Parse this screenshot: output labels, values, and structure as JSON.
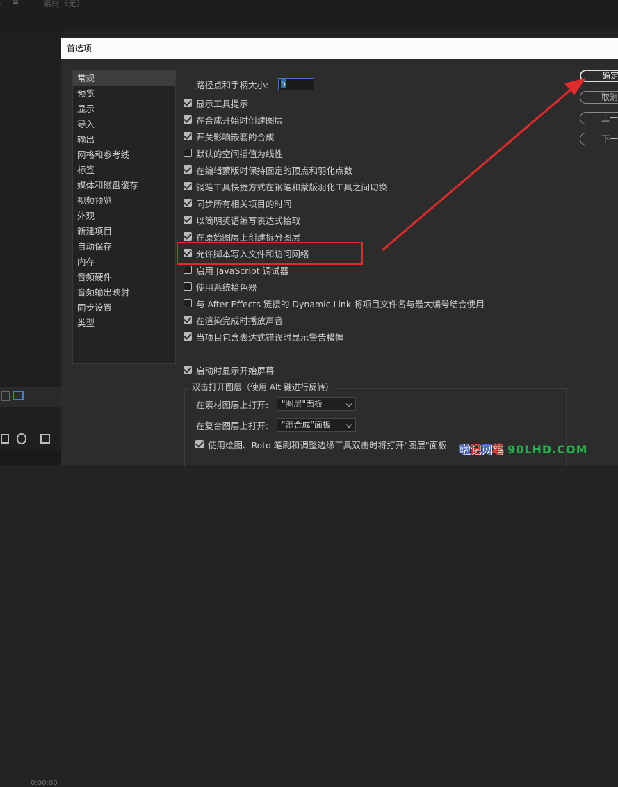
{
  "background_app": {
    "tab_active": "1",
    "menu_glyph": "≡",
    "tab_media": "素材（无）",
    "timecode": "0:00:00"
  },
  "dialog": {
    "title": "首选项",
    "sidebar": [
      {
        "label": "常规",
        "selected": true
      },
      {
        "label": "预览"
      },
      {
        "label": "显示"
      },
      {
        "label": "导入"
      },
      {
        "label": "输出"
      },
      {
        "label": "网格和参考线"
      },
      {
        "label": "标签"
      },
      {
        "label": "媒体和磁盘缓存"
      },
      {
        "label": "视频预览"
      },
      {
        "label": "外观"
      },
      {
        "label": "新建项目"
      },
      {
        "label": "自动保存"
      },
      {
        "label": "内存"
      },
      {
        "label": "音频硬件"
      },
      {
        "label": "音频输出映射"
      },
      {
        "label": "同步设置"
      },
      {
        "label": "类型"
      }
    ],
    "path_size": {
      "label": "路径点和手柄大小:",
      "value": "5"
    },
    "options": [
      {
        "label": "显示工具提示",
        "checked": true
      },
      {
        "label": "在合成开始时创建图层",
        "checked": true
      },
      {
        "label": "开关影响嵌套的合成",
        "checked": true
      },
      {
        "label": "默认的空间插值为线性",
        "checked": false
      },
      {
        "label": "在编辑蒙版时保持固定的顶点和羽化点数",
        "checked": true
      },
      {
        "label": "钢笔工具快捷方式在钢笔和蒙版羽化工具之间切换",
        "checked": true
      },
      {
        "label": "同步所有相关项目的时间",
        "checked": true
      },
      {
        "label": "以简明英语编写表达式拾取",
        "checked": true
      },
      {
        "label": "在原始图层上创建拆分图层",
        "checked": true
      },
      {
        "label": "允许脚本写入文件和访问网络",
        "checked": true
      },
      {
        "label": "启用 JavaScript 调试器",
        "checked": false
      },
      {
        "label": "使用系统拾色器",
        "checked": false
      },
      {
        "label": "与 After Effects 链接的 Dynamic Link 将项目文件名与最大编号结合使用",
        "checked": false
      },
      {
        "label": "在渲染完成时播放声音",
        "checked": true
      },
      {
        "label": "当项目包含表达式错误时显示警告横幅",
        "checked": true
      }
    ],
    "startup_screen": {
      "label": "启动时显示开始屏幕",
      "checked": true
    },
    "double_click_group": {
      "title": "双击打开图层（使用 Alt 键进行反转）",
      "footage_label": "在素材图层上打开:",
      "footage_value": "\"图层\"面板",
      "comp_label": "在复合图层上打开:",
      "comp_value": "\"源合成\"面板",
      "paint_option": {
        "label": "使用绘图、Roto 笔刷和调整边缘工具双击时将打开\"图层\"面板",
        "checked": true
      }
    },
    "buttons": {
      "ok": "确定",
      "cancel": "取消",
      "prev": "上一步",
      "next": "下一步"
    }
  },
  "annotation": {
    "color": "#e22a2a"
  },
  "watermark": {
    "part1": "啦",
    "part2": "记",
    "part3": "网",
    "part4": "笔",
    "site": "90LHD.COM"
  }
}
